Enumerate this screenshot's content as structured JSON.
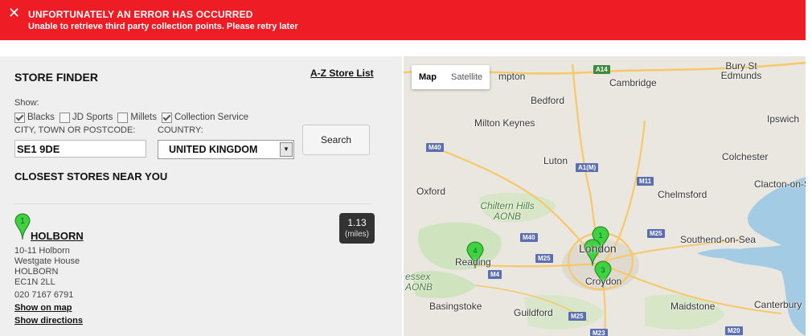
{
  "error": {
    "title": "UNFORTUNATELY AN ERROR HAS OCCURRED",
    "message": "Unable to retrieve third party collection points. Please retry later"
  },
  "finder": {
    "title": "STORE FINDER",
    "az_link": "A-Z Store List",
    "show_label": "Show:",
    "filters": [
      {
        "label": "Blacks",
        "checked": true
      },
      {
        "label": "JD Sports",
        "checked": false
      },
      {
        "label": "Millets",
        "checked": false
      },
      {
        "label": "Collection Service",
        "checked": true
      }
    ],
    "city_label": "CITY, TOWN OR POSTCODE:",
    "country_label": "COUNTRY:",
    "postcode_value": "SE1 9DE",
    "country_value": "UNITED KINGDOM",
    "search_label": "Search",
    "closest_heading": "CLOSEST STORES NEAR YOU"
  },
  "stores": [
    {
      "pin": "1",
      "name": "HOLBORN",
      "distance": "1.13",
      "distance_unit": "(miles)",
      "address": [
        "10-11 Holborn",
        "Westgate House",
        "HOLBORN",
        "EC1N 2LL"
      ],
      "phone": "020 7167 6791",
      "show_on_map": "Show on map",
      "show_directions": "Show directions"
    }
  ],
  "map": {
    "tabs": [
      {
        "label": "Map",
        "active": true
      },
      {
        "label": "Satellite",
        "active": false
      }
    ],
    "cities": [
      "mpton",
      "Bury St Edmunds",
      "Cambridge",
      "Bedford",
      "Milton Keynes",
      "Ipswich",
      "Luton",
      "Colchester",
      "Oxford",
      "Chelmsford",
      "Clacton-on-S",
      "Chiltern Hills AONB",
      "Southend-on-Sea",
      "London",
      "Reading",
      "Croydon",
      "essex AONB",
      "Basingstoke",
      "Guildford",
      "Maidstone",
      "Canterbury"
    ],
    "roads": [
      "A14",
      "M40",
      "A1(M)",
      "M11",
      "M25",
      "M40",
      "M25",
      "M4",
      "M25",
      "M23",
      "M20"
    ],
    "pins": [
      "1",
      "2",
      "3",
      "4"
    ],
    "pin_color": "#3fd13f"
  }
}
